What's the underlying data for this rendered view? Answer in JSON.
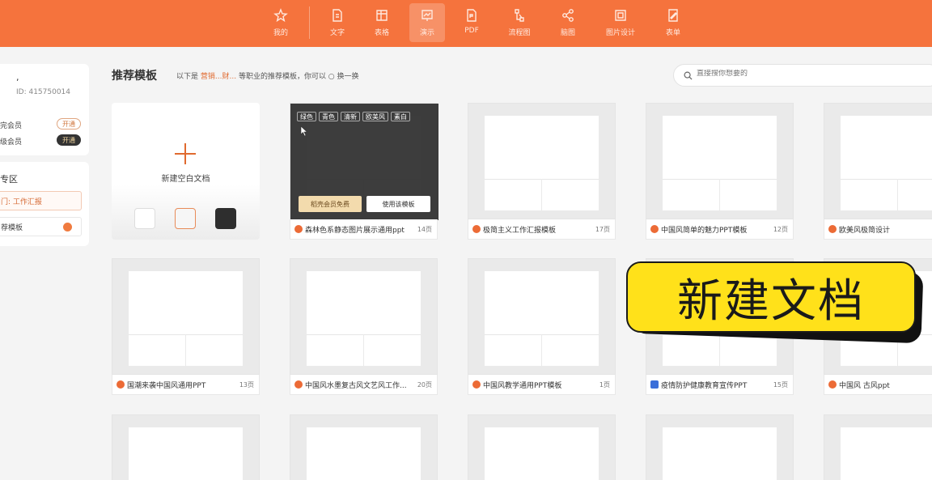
{
  "topbar": {
    "tabs": [
      {
        "label": "我的",
        "icon": "star-icon"
      },
      {
        "label": "文字",
        "icon": "doc-icon"
      },
      {
        "label": "表格",
        "icon": "table-icon"
      },
      {
        "label": "演示",
        "icon": "presentation-icon",
        "active": true
      },
      {
        "label": "PDF",
        "icon": "pdf-icon"
      },
      {
        "label": "流程图",
        "icon": "flowchart-icon"
      },
      {
        "label": "脑图",
        "icon": "mindmap-icon"
      },
      {
        "label": "图片设计",
        "icon": "image-design-icon"
      },
      {
        "label": "表单",
        "icon": "form-icon"
      }
    ],
    "accent": "#f5733d"
  },
  "sidebar": {
    "user_name": ",",
    "user_id": "ID: 415750014",
    "memberships": [
      {
        "label": "完会员",
        "action": "开通"
      },
      {
        "label": "级会员",
        "action": "开通"
      }
    ],
    "zone_title": "专区",
    "zone_item1": "门: 工作汇报",
    "zone_item2": "荐模板"
  },
  "header": {
    "title": "推荐模板",
    "subtitle_prefix": "以下是",
    "subtitle_highlight": "营销...财...",
    "subtitle_suffix": "等职业的推荐模板，你可以 ○ 换一换",
    "search_placeholder": "直接搜你想要的"
  },
  "new_doc": {
    "label": "新建空白文档"
  },
  "hover_card": {
    "tags": [
      "绿色",
      "青色",
      "清新",
      "欧美风",
      "素白"
    ],
    "member_button": "稻壳会员免费",
    "use_button": "使用该模板"
  },
  "templates_row1": [
    {
      "title": "森林色系静态图片展示通用ppt",
      "pages": "14页"
    },
    {
      "title": "极简主义工作汇报模板",
      "pages": "17页"
    },
    {
      "title": "中国风简单的魅力PPT模板",
      "pages": "12页"
    },
    {
      "title": "欧美风极简设计",
      "pages": ""
    }
  ],
  "templates_row2": [
    {
      "title": "国潮来袭中国风通用PPT",
      "pages": "13页"
    },
    {
      "title": "中国风水墨复古风文艺风工作...",
      "pages": "20页"
    },
    {
      "title": "中国风教学通用PPT模板",
      "pages": "1页"
    },
    {
      "title": "疫情防护健康教育宣传PPT",
      "pages": "15页"
    },
    {
      "title": "中国风 古风ppt",
      "pages": ""
    }
  ],
  "sticker": {
    "text": "新建文档",
    "color": "#ffe11a"
  }
}
